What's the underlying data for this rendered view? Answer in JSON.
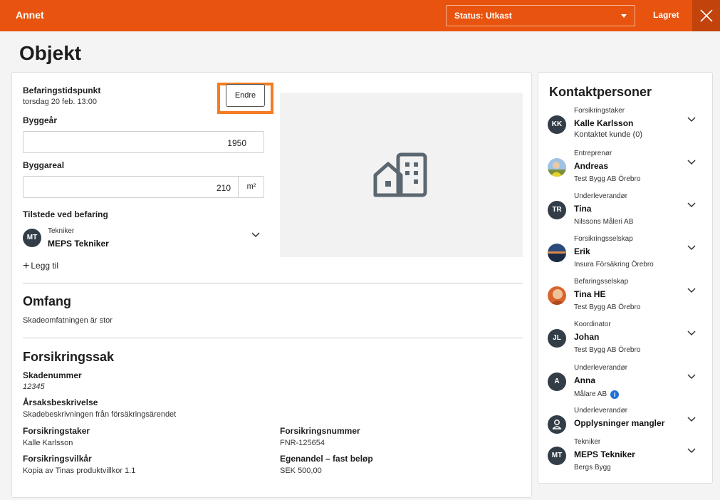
{
  "header": {
    "title": "Annet",
    "status_label": "Status: Utkast",
    "saved_label": "Lagret"
  },
  "page": {
    "title": "Objekt"
  },
  "inspection": {
    "time_label": "Befaringstidspunkt",
    "time_value": "torsdag 20 feb. 13:00",
    "edit_label": "Endre",
    "year_label": "Byggeår",
    "year_value": "1950",
    "area_label": "Byggareal",
    "area_value": "210",
    "area_unit": "m²",
    "present_label": "Tilstede ved befaring",
    "present_person": {
      "initials": "MT",
      "role": "Tekniker",
      "name": "MEPS Tekniker"
    },
    "add_label": "Legg til"
  },
  "scope": {
    "title": "Omfang",
    "text": "Skadeomfatningen är stor"
  },
  "claim": {
    "title": "Forsikringssak",
    "claim_number_label": "Skadenummer",
    "claim_number": "12345",
    "cause_label": "Årsaksbeskrivelse",
    "cause_text": "Skadebeskrivningen från försäkringsärendet",
    "policyholder_label": "Forsikringstaker",
    "policyholder": "Kalle Karlsson",
    "policy_number_label": "Forsikringsnummer",
    "policy_number": "FNR-125654",
    "terms_label": "Forsikringsvilkår",
    "terms": "Kopia av Tinas produktvillkor 1.1",
    "deductible_label": "Egenandel – fast beløp",
    "deductible": "SEK 500,00"
  },
  "contacts": {
    "title": "Kontaktpersoner",
    "items": [
      {
        "initials": "KK",
        "role": "Forsikringstaker",
        "name": "Kalle Karlsson",
        "company": "Kontaktet kunde (0)"
      },
      {
        "initials": "",
        "role": "Entreprenør",
        "name": "Andreas",
        "company": "Test Bygg AB Örebro"
      },
      {
        "initials": "TR",
        "role": "Underleverandør",
        "name": "Tina",
        "company": "Nilssons Måleri AB"
      },
      {
        "initials": "",
        "role": "Forsikringsselskap",
        "name": "Erik",
        "company": "Insura Försäkring Örebro"
      },
      {
        "initials": "",
        "role": "Befaringsselskap",
        "name": "Tina HE",
        "company": "Test Bygg AB Örebro"
      },
      {
        "initials": "JL",
        "role": "Koordinator",
        "name": "Johan",
        "company": "Test Bygg AB Örebro"
      },
      {
        "initials": "A",
        "role": "Underleverandør",
        "name": "Anna",
        "company": "Målare AB"
      },
      {
        "initials": "",
        "role": "Underleverandør",
        "name": "Opplysninger mangler",
        "company": ""
      },
      {
        "initials": "MT",
        "role": "Tekniker",
        "name": "MEPS Tekniker",
        "company": "Bergs Bygg"
      }
    ]
  },
  "colors": {
    "brand": "#e8540f",
    "highlight": "#f57c1f",
    "avatar": "#333d47",
    "info": "#1f6fd6"
  }
}
